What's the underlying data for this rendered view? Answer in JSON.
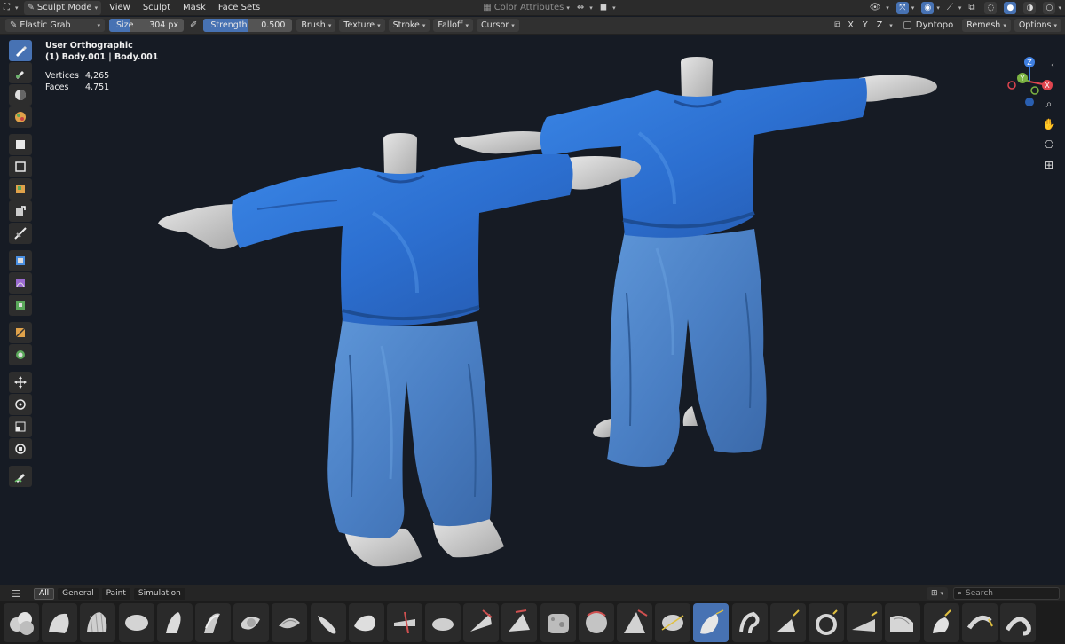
{
  "header1": {
    "editor_icon": "editor-type-icon",
    "mode": "Sculpt Mode",
    "menus": [
      "View",
      "Sculpt",
      "Mask",
      "Face Sets"
    ],
    "color_attributes": "Color Attributes"
  },
  "header2": {
    "brush_name": "Elastic Grab",
    "size_label": "Size",
    "size_value": "304 px",
    "strength_label": "Strength",
    "strength_value": "0.500",
    "strength_fraction": 0.5,
    "dropdowns": [
      "Brush",
      "Texture",
      "Stroke",
      "Falloff",
      "Cursor"
    ],
    "axes": [
      "X",
      "Y",
      "Z"
    ],
    "dyntopo": "Dyntopo",
    "remesh": "Remesh",
    "options": "Options"
  },
  "viewport": {
    "view_name": "User Orthographic",
    "object_name": "(1) Body.001 | Body.001",
    "stats": [
      {
        "label": "Vertices",
        "value": "4,265"
      },
      {
        "label": "Faces",
        "value": "4,751"
      }
    ],
    "background_color": "#161b24",
    "accent_color": "#4772b3"
  },
  "gizmo": {
    "x_label": "X",
    "y_label": "Y",
    "z_label": "Z",
    "x_color": "#e0454f",
    "y_color": "#7cb342",
    "z_color": "#3f7fe0"
  },
  "shelf": {
    "tabs": [
      "All",
      "General",
      "Paint",
      "Simulation"
    ],
    "active_tab": "All",
    "search_placeholder": "Search",
    "brush_count": 27,
    "active_brush_index": 18
  }
}
